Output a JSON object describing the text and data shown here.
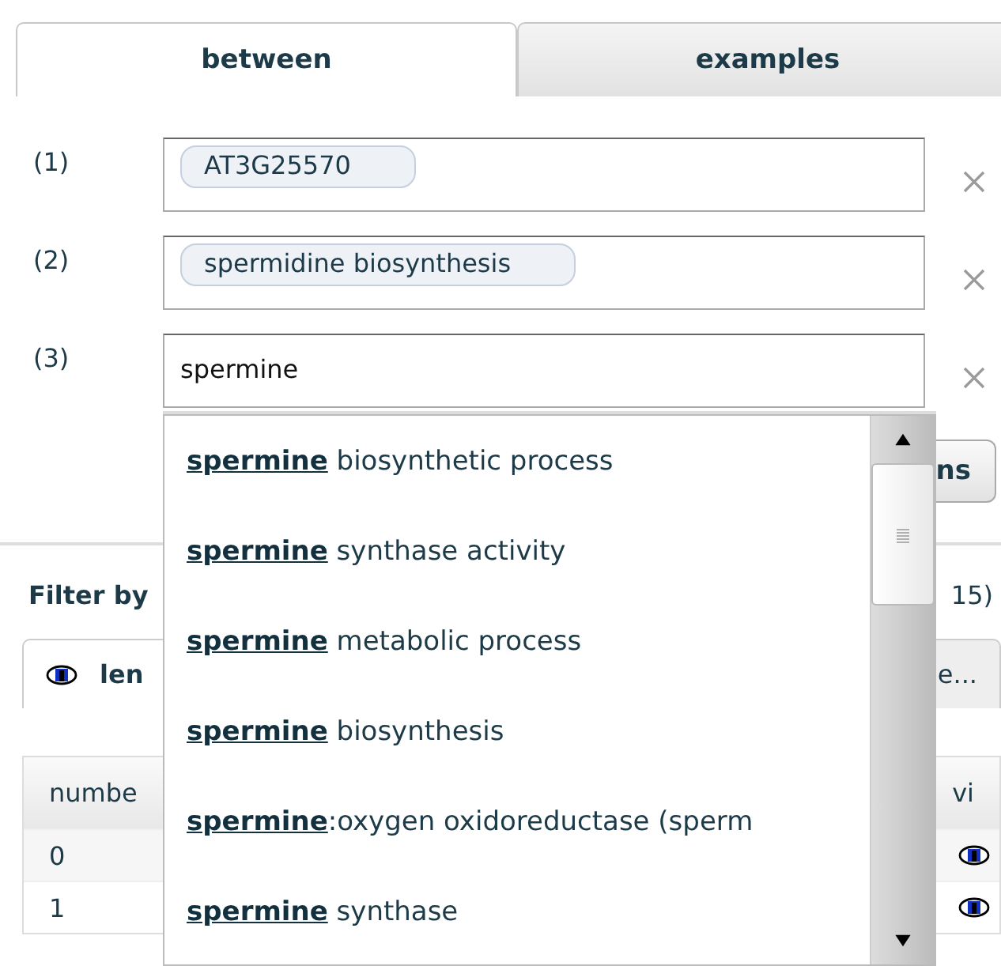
{
  "tabs": [
    {
      "label": "between",
      "selected": true
    },
    {
      "label": "examples",
      "selected": false
    }
  ],
  "inputs": [
    {
      "index": "(1)",
      "tokens": [
        "AT3G25570"
      ]
    },
    {
      "index": "(2)",
      "tokens": [
        "spermidine biosynthesis"
      ]
    },
    {
      "index": "(3)",
      "value": "spermine"
    }
  ],
  "button": "ns",
  "filter": {
    "label": "Filter by",
    "count": "15)"
  },
  "filter_tabs": [
    {
      "label": "len",
      "selected": true
    },
    {
      "label": "e...",
      "selected": false
    }
  ],
  "table": {
    "columns": [
      "numbe",
      "vi"
    ],
    "rows": [
      {
        "cells": [
          "0"
        ]
      },
      {
        "cells": [
          "1"
        ]
      }
    ]
  },
  "suggestions": [
    "**spermine** biosynthetic process",
    "**spermine** synthase activity",
    "**spermine** metabolic process",
    "**spermine** biosynthesis",
    "**spermine**:oxygen oxidoreductase (sperm",
    "**spermine** synthase"
  ]
}
